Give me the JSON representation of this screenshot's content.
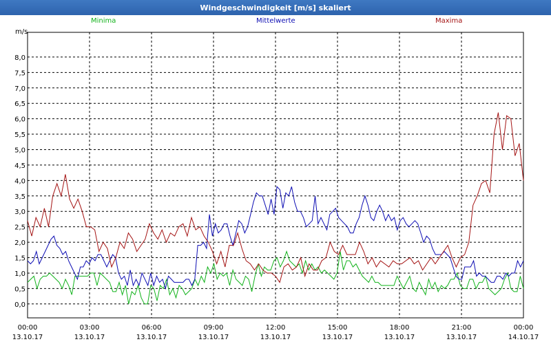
{
  "window": {
    "title": "Windgeschwindigkeit [m/s] skaliert"
  },
  "colors": {
    "minima": "#11b21a",
    "mittelwerte": "#0c0cb3",
    "maxima": "#a31111"
  },
  "chart_data": {
    "type": "line",
    "title": "Windgeschwindigkeit [m/s] skaliert",
    "ylabel": "m/s",
    "ylim": [
      -0.45,
      8.8
    ],
    "yticks": [
      "0,0",
      "0,5",
      "1,0",
      "1,5",
      "2,0",
      "2,5",
      "3,0",
      "3,5",
      "4,0",
      "4,5",
      "5,0",
      "5,5",
      "6,0",
      "6,5",
      "7,0",
      "7,5",
      "8,0"
    ],
    "xlim": [
      0,
      24
    ],
    "xticks": [
      {
        "time": "00:00",
        "date": "13.10.17"
      },
      {
        "time": "03:00",
        "date": "13.10.17"
      },
      {
        "time": "06:00",
        "date": "13.10.17"
      },
      {
        "time": "09:00",
        "date": "13.10.17"
      },
      {
        "time": "12:00",
        "date": "13.10.17"
      },
      {
        "time": "15:00",
        "date": "13.10.17"
      },
      {
        "time": "18:00",
        "date": "13.10.17"
      },
      {
        "time": "21:00",
        "date": "13.10.17"
      },
      {
        "time": "00:00",
        "date": "14.10.17"
      }
    ],
    "grid": true,
    "legend": "top",
    "series": [
      {
        "name": "Minima",
        "values": [
          0.7,
          0.8,
          0.9,
          0.5,
          0.8,
          0.9,
          0.9,
          1.0,
          0.9,
          0.8,
          0.7,
          0.5,
          0.8,
          0.6,
          0.3,
          0.9,
          0.9,
          0.9,
          0.9,
          0.9,
          1.0,
          1.0,
          0.6,
          1.0,
          0.9,
          0.8,
          0.7,
          0.4,
          0.4,
          0.7,
          0.3,
          0.6,
          0.0,
          0.4,
          0.3,
          0.6,
          0.2,
          0.0,
          0.0,
          0.6,
          0.5,
          0.1,
          0.6,
          0.5,
          0.8,
          0.3,
          0.5,
          0.2,
          0.6,
          0.5,
          0.3,
          0.4,
          0.5,
          0.8,
          0.6,
          0.9,
          0.7,
          1.2,
          1.0,
          1.3,
          0.8,
          1.0,
          0.9,
          1.0,
          0.6,
          1.1,
          0.8,
          0.7,
          0.6,
          0.9,
          0.8,
          0.4,
          0.9,
          1.3,
          0.9,
          1.2,
          1.1,
          1.1,
          1.4,
          1.5,
          1.2,
          1.4,
          1.7,
          1.4,
          1.3,
          1.2,
          1.3,
          1.0,
          1.4,
          1.1,
          1.3,
          1.1,
          1.2,
          1.0,
          1.1,
          1.0,
          0.9,
          0.8,
          1.0,
          1.7,
          1.1,
          1.4,
          1.4,
          1.2,
          1.3,
          1.1,
          0.9,
          0.8,
          0.7,
          0.9,
          0.7,
          0.7,
          0.6,
          0.6,
          0.6,
          0.6,
          0.6,
          0.9,
          0.7,
          0.5,
          0.7,
          0.9,
          0.5,
          0.4,
          0.7,
          0.5,
          0.3,
          0.8,
          0.5,
          0.7,
          0.4,
          0.6,
          0.5,
          0.6,
          0.8,
          0.8,
          1.0,
          0.6,
          0.5,
          0.5,
          0.8,
          0.8,
          0.5,
          0.7,
          0.7,
          0.9,
          0.5,
          0.4,
          0.3,
          0.4,
          0.5,
          0.8,
          1.0,
          0.5,
          0.4,
          0.4,
          0.9,
          0.5
        ]
      },
      {
        "name": "Mittelwerte",
        "values": [
          1.4,
          1.3,
          1.4,
          1.7,
          1.3,
          1.5,
          1.7,
          1.9,
          2.1,
          2.2,
          1.9,
          1.8,
          1.6,
          1.7,
          1.4,
          1.2,
          1.0,
          0.8,
          1.2,
          1.2,
          1.4,
          1.3,
          1.5,
          1.4,
          1.6,
          1.6,
          1.4,
          1.2,
          1.4,
          1.6,
          1.5,
          1.0,
          0.8,
          0.9,
          0.6,
          1.1,
          0.6,
          0.8,
          0.6,
          1.0,
          0.8,
          0.6,
          1.0,
          0.6,
          0.9,
          0.7,
          0.8,
          0.5,
          0.9,
          0.8,
          0.7,
          0.7,
          0.7,
          0.7,
          0.8,
          0.8,
          0.6,
          0.8,
          1.9,
          1.9,
          2.0,
          1.8,
          2.9,
          2.2,
          2.6,
          2.3,
          2.4,
          2.6,
          2.6,
          2.2,
          1.9,
          2.3,
          2.7,
          2.6,
          2.3,
          2.5,
          2.9,
          3.3,
          3.6,
          3.5,
          3.5,
          3.2,
          2.9,
          3.4,
          2.9,
          3.8,
          3.7,
          3.1,
          3.6,
          3.5,
          3.8,
          3.3,
          3.0,
          3.0,
          2.8,
          2.5,
          2.6,
          2.7,
          3.5,
          2.6,
          2.8,
          2.6,
          2.4,
          2.9,
          3.0,
          3.1,
          2.8,
          2.7,
          2.6,
          2.5,
          2.3,
          2.3,
          2.6,
          2.8,
          3.2,
          3.5,
          3.2,
          2.8,
          2.7,
          3.0,
          3.2,
          3.0,
          2.7,
          2.9,
          2.7,
          2.8,
          2.4,
          2.7,
          2.8,
          2.6,
          2.5,
          2.6,
          2.7,
          2.6,
          2.3,
          2.0,
          2.2,
          2.1,
          1.8,
          1.6,
          1.6,
          1.6,
          1.7,
          1.6,
          1.5,
          1.2,
          0.9,
          0.8,
          0.8,
          1.2,
          1.2,
          1.2,
          1.4,
          0.9,
          1.0,
          0.9,
          0.9,
          0.8,
          0.7,
          0.7,
          0.9,
          0.9,
          0.8,
          1.0,
          0.9,
          1.0,
          1.0,
          1.4,
          1.2,
          1.4
        ]
      },
      {
        "name": "Maxima",
        "values": [
          2.7,
          2.2,
          2.8,
          2.5,
          3.1,
          2.5,
          3.5,
          3.9,
          3.5,
          4.2,
          3.4,
          3.1,
          3.4,
          3.0,
          2.5,
          2.5,
          2.4,
          1.7,
          2.0,
          1.8,
          1.2,
          1.5,
          2.0,
          1.8,
          2.3,
          2.1,
          1.7,
          1.9,
          2.1,
          2.6,
          2.3,
          2.1,
          2.4,
          2.0,
          2.3,
          2.2,
          2.5,
          2.6,
          2.2,
          2.8,
          2.4,
          2.5,
          2.2,
          2.0,
          1.7,
          1.3,
          1.7,
          1.2,
          1.9,
          1.9,
          2.3,
          1.8,
          1.4,
          1.3,
          1.1,
          1.3,
          1.1,
          1.0,
          1.0,
          0.9,
          0.7,
          1.2,
          1.3,
          1.1,
          1.2,
          1.5,
          0.9,
          1.3,
          1.1,
          1.1,
          1.4,
          1.5,
          2.0,
          1.7,
          1.6,
          1.9,
          1.6,
          1.6,
          1.6,
          2.0,
          1.7,
          1.3,
          1.5,
          1.2,
          1.4,
          1.3,
          1.2,
          1.4,
          1.3,
          1.3,
          1.4,
          1.5,
          1.3,
          1.4,
          1.1,
          1.3,
          1.5,
          1.3,
          1.5,
          1.7,
          1.9,
          1.5,
          1.2,
          1.5,
          1.6,
          2.0,
          3.2,
          3.5,
          3.9,
          4.0,
          3.6,
          5.5,
          6.2,
          5.0,
          6.1,
          6.0,
          4.8,
          5.2,
          4.0
        ]
      }
    ]
  }
}
